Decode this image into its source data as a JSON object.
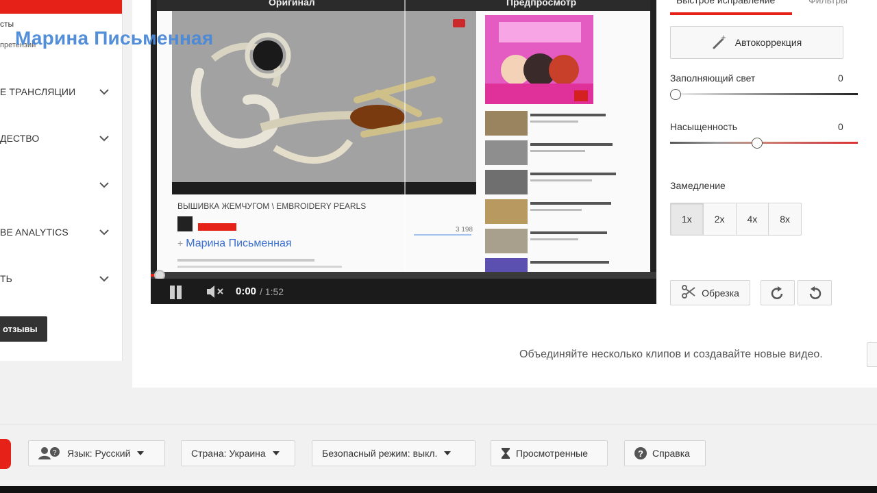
{
  "sidebar": {
    "small_items": [
      "сты",
      "претензий"
    ],
    "items": [
      {
        "label": "Е ТРАНСЛЯЦИИ"
      },
      {
        "label": "ДЕСТВО"
      },
      {
        "label": ""
      },
      {
        "label": "BE ANALYTICS"
      },
      {
        "label": "ТЬ"
      }
    ],
    "feedback_label": "отзывы"
  },
  "watermark": "Марина Письменная",
  "video": {
    "original_label": "Оригинал",
    "preview_label": "Предпросмотр",
    "title": "ВЫШИВКА ЖЕМЧУГОМ \\ EMBROIDERY PEARLS",
    "views": "3 198",
    "author": "Марина Письменная",
    "author_prefix": "+",
    "current_time": "0:00",
    "duration": "/ 1:52",
    "progress": 0
  },
  "editor": {
    "tab_quickfix": "Быстрое исправление",
    "tab_filters": "Фильтры",
    "autofix_label": "Автокоррекция",
    "fill_light": {
      "label": "Заполняющий свет",
      "value": "0"
    },
    "saturation": {
      "label": "Насыщенность",
      "value": "0"
    },
    "slowmo_label": "Замедление",
    "speeds": [
      "1x",
      "2x",
      "4x",
      "8x"
    ],
    "active_speed": "1x",
    "trim_label": "Обрезка"
  },
  "merge_text": "Объединяйте несколько клипов и создавайте новые видео.",
  "footer": {
    "language": "Язык: Русский",
    "country": "Страна: Украина",
    "safety": "Безопасный режим: выкл.",
    "history": "Просмотренные",
    "help": "Справка"
  },
  "colors": {
    "accent": "#e62117",
    "watermark": "#4a89d8"
  }
}
